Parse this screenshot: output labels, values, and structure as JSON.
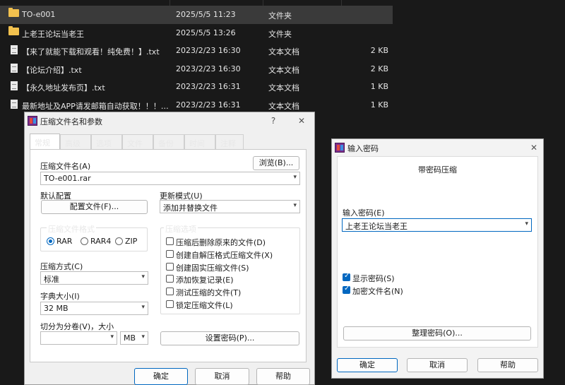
{
  "files": [
    {
      "name": "TO-e001",
      "date": "2025/5/5 11:23",
      "type": "文件夹",
      "size": "",
      "icon": "folder-icon",
      "selected": true
    },
    {
      "name": "上老王论坛当老王",
      "date": "2025/5/5 13:26",
      "type": "文件夹",
      "size": "",
      "icon": "folder-icon"
    },
    {
      "name": "【来了就能下载和观看！纯免费！】.txt",
      "date": "2023/2/23 16:30",
      "type": "文本文档",
      "size": "2 KB",
      "icon": "text-file-icon"
    },
    {
      "name": "【论坛介绍】.txt",
      "date": "2023/2/23 16:30",
      "type": "文本文档",
      "size": "2 KB",
      "icon": "text-file-icon"
    },
    {
      "name": "【永久地址发布页】.txt",
      "date": "2023/2/23 16:31",
      "type": "文本文档",
      "size": "1 KB",
      "icon": "text-file-icon"
    },
    {
      "name": "最新地址及APP请发邮箱自动获取！！！....",
      "date": "2023/2/23 16:31",
      "type": "文本文档",
      "size": "1 KB",
      "icon": "text-file-icon"
    }
  ],
  "archive_dialog": {
    "title": "压缩文件名和参数",
    "help_glyph": "?",
    "close_glyph": "✕",
    "tabs": [
      "常规",
      "高级",
      "选项",
      "文件",
      "备份",
      "时间",
      "注释"
    ],
    "archive_name_label": "压缩文件名(A)",
    "browse_button": "浏览(B)...",
    "archive_name_value": "TO-e001.rar",
    "default_profile_label": "默认配置",
    "profiles_button": "配置文件(F)...",
    "update_mode_label": "更新模式(U)",
    "update_mode_value": "添加并替换文件",
    "format_group": "压缩文件格式",
    "formats": [
      "RAR",
      "RAR4",
      "ZIP"
    ],
    "options_group": "压缩选项",
    "options": [
      "压缩后删除原来的文件(D)",
      "创建自解压格式压缩文件(X)",
      "创建固实压缩文件(S)",
      "添加恢复记录(E)",
      "测试压缩的文件(T)",
      "锁定压缩文件(L)"
    ],
    "method_label": "压缩方式(C)",
    "method_value": "标准",
    "dict_label": "字典大小(I)",
    "dict_value": "32 MB",
    "split_label": "切分为分卷(V)，大小",
    "split_value": "",
    "split_unit": "MB",
    "set_password_button": "设置密码(P)...",
    "ok_button": "确定",
    "cancel_button": "取消",
    "help_button": "帮助"
  },
  "password_dialog": {
    "title": "输入密码",
    "close_glyph": "✕",
    "heading": "带密码压缩",
    "password_label": "输入密码(E)",
    "password_value": "上老王论坛当老王",
    "show_password": "显示密码(S)",
    "encrypt_names": "加密文件名(N)",
    "organize_button": "整理密码(O)...",
    "ok_button": "确定",
    "cancel_button": "取消",
    "help_button": "帮助"
  },
  "colors": {
    "accent": "#0067c0",
    "folder": "#f2c14e",
    "explorer_bg": "#191919"
  }
}
